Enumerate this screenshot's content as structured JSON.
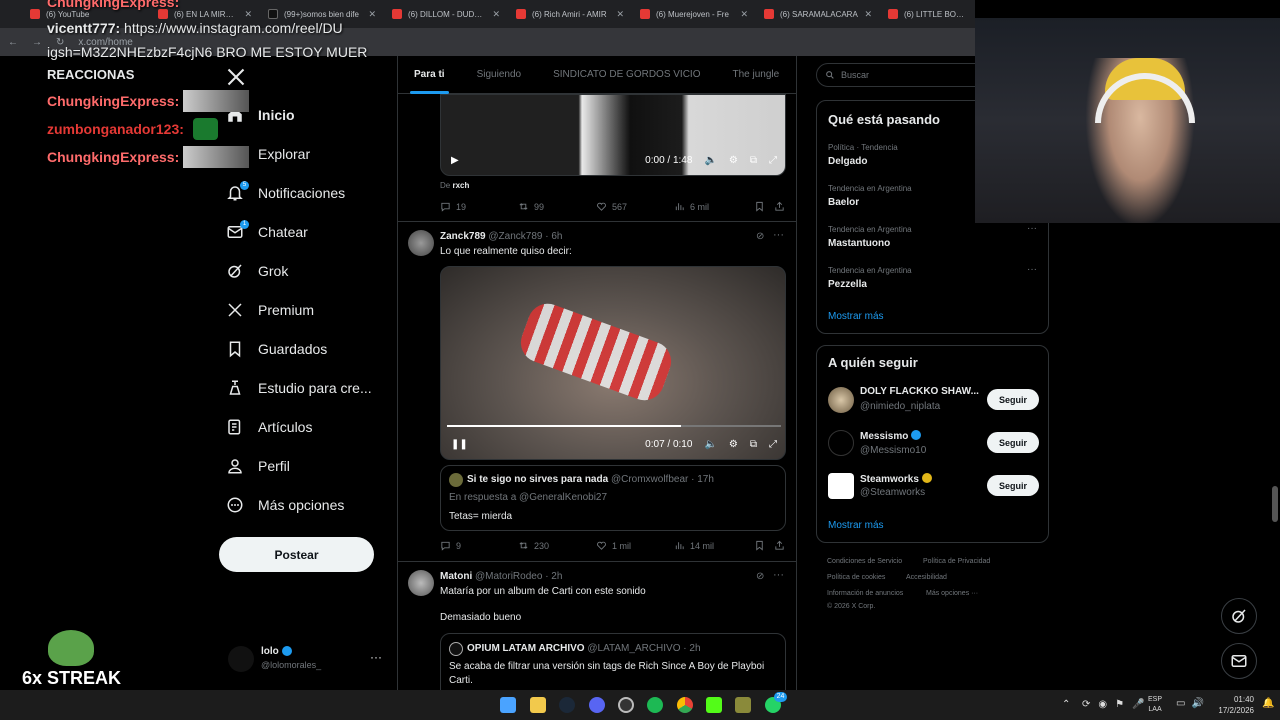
{
  "tabs": [
    {
      "label": "(6) YouTube"
    },
    {
      "label": "(6) EN LA MIRA · Iba"
    },
    {
      "label": "(99+)somos bien dife"
    },
    {
      "label": "(6) DILLOM - DUDADE"
    },
    {
      "label": "(6) Rich Amiri - AMIR"
    },
    {
      "label": "(6) Muerejoven - Fre"
    },
    {
      "label": "(6) SARAMALACARA"
    },
    {
      "label": "(6) LITTLE BOOGIE"
    }
  ],
  "address": "x.com/home",
  "chat": [
    {
      "user": "ChungkingExpress",
      "msg": "",
      "color": "#ff6b6b"
    },
    {
      "user": "vicentt777",
      "msg": "https://www.instagram.com/reel/DU",
      "color": "#ffffff"
    },
    {
      "user": "",
      "msg": "igsh=M3Z2NHEzbzF4cjN6 BRO ME ESTOY MUER",
      "color": "#ffffff"
    },
    {
      "user": "",
      "msg": "REACCIONAS",
      "color": "#ffffff"
    },
    {
      "user": "ChungkingExpress",
      "msg": "",
      "color": "#ff6b6b"
    },
    {
      "user": "zumbonganador123",
      "msg": "",
      "color": "#e53935"
    },
    {
      "user": "ChungkingExpress",
      "msg": "",
      "color": "#ff6b6b"
    }
  ],
  "streak": "6x STREAK",
  "nav": {
    "items": [
      {
        "label": "Inicio",
        "icon": "home-icon"
      },
      {
        "label": "Explorar",
        "icon": "search-icon"
      },
      {
        "label": "Notificaciones",
        "icon": "bell-icon"
      },
      {
        "label": "Chatear",
        "icon": "mail-icon"
      },
      {
        "label": "Grok",
        "icon": "grok-icon"
      },
      {
        "label": "Premium",
        "icon": "x-logo-icon"
      },
      {
        "label": "Guardados",
        "icon": "bookmark-icon"
      },
      {
        "label": "Estudio para cre...",
        "icon": "studio-icon"
      },
      {
        "label": "Artículos",
        "icon": "article-icon"
      },
      {
        "label": "Perfil",
        "icon": "person-icon"
      },
      {
        "label": "Más opciones",
        "icon": "more-circle-icon"
      }
    ],
    "badges": {
      "notifications": "5",
      "chat": "1"
    },
    "post_label": "Postear",
    "account": {
      "name": "lolo",
      "handle": "@lolomorales_"
    }
  },
  "timeline": {
    "tabs": [
      "Para ti",
      "Siguiendo",
      "SINDICATO DE GORDOS VICIO",
      "The jungle"
    ],
    "post1": {
      "time": "0:00 / 1:48",
      "from_prefix": "De",
      "from": "rxch",
      "replies": "19",
      "reposts": "99",
      "likes": "567",
      "views": "6 mil"
    },
    "post2": {
      "name": "Zanck789",
      "handle": "@Zanck789",
      "age": "· 6h",
      "text": "Lo que realmente quiso decir:",
      "time": "0:07 / 0:10",
      "quote": {
        "name": "Si te sigo no sirves para nada",
        "handle": "@Cromxwolfbear",
        "age": "· 17h",
        "reply_to": "En respuesta a @GeneralKenobi27",
        "text": "Tetas= mierda"
      },
      "replies": "9",
      "reposts": "230",
      "likes": "1 mil",
      "views": "14 mil"
    },
    "post3": {
      "name": "Matoni",
      "handle": "@MatoriRodeo",
      "age": "· 2h",
      "text": "Mataría por un album de Carti con este sonido",
      "text2": "Demasiado bueno",
      "quote": {
        "name": "OPIUM LATAM ARCHIVO",
        "handle": "@LATAM_ARCHIVO",
        "age": "· 2h",
        "text": "Se acaba de filtrar una versión sin tags de Rich Since A Boy de Playboi",
        "text2": "Carti."
      }
    }
  },
  "right": {
    "search_placeholder": "Buscar",
    "trends_title": "Qué está pasando",
    "trends": [
      {
        "meta": "Política · Tendencia",
        "name": "Delgado"
      },
      {
        "meta": "Tendencia en Argentina",
        "name": "Baelor"
      },
      {
        "meta": "Tendencia en Argentina",
        "name": "Mastantuono"
      },
      {
        "meta": "Tendencia en Argentina",
        "name": "Pezzella"
      }
    ],
    "show_more": "Mostrar más",
    "wtf_title": "A quién seguir",
    "wtf": [
      {
        "name": "DOLY FLACKKO SHAW...",
        "handle": "@nimiedo_niplata"
      },
      {
        "name": "Messismo",
        "handle": "@Messismo10"
      },
      {
        "name": "Steamworks",
        "handle": "@Steamworks"
      }
    ],
    "follow_label": "Seguir",
    "footer": [
      "Condiciones de Servicio",
      "Política de Privacidad",
      "Política de cookies",
      "Accesibilidad",
      "Información de anuncios",
      "Más opciones ···",
      "© 2026 X Corp."
    ]
  },
  "taskbar": {
    "lang": "ESP",
    "lang2": "LAA",
    "time": "01:40",
    "date": "17/2/2026",
    "whatsapp_badge": "24"
  }
}
